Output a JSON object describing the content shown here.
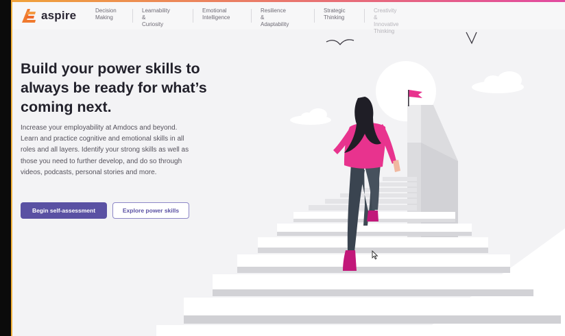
{
  "brand": {
    "name": "aspire",
    "colors": {
      "accent": "#f07a2e",
      "primary": "#5a51a3",
      "pink": "#e8338e"
    }
  },
  "nav": [
    {
      "label": "Decision\nMaking",
      "faded": false
    },
    {
      "label": "Learnability &\nCuriosity",
      "faded": false
    },
    {
      "label": "Emotional\nIntelligence",
      "faded": false
    },
    {
      "label": "Resilience &\nAdaptability",
      "faded": false
    },
    {
      "label": "Strategic\nThinking",
      "faded": false
    },
    {
      "label": "Creativity &\nInnovative Thinking",
      "faded": true
    }
  ],
  "hero": {
    "headline": "Build your power skills to always be ready for what’s coming next.",
    "intro": "Increase your employability at Amdocs and beyond. Learn and practice cognitive and emotional skills in all roles and all layers. Identify your strong skills as well as those you need to further develop, and do so through videos, podcasts, personal stories and more.",
    "primary_button": "Begin self-assessment",
    "secondary_button": "Explore power skills"
  },
  "illustration": {
    "icons": [
      "bird-icon",
      "flag-icon",
      "cloud-icon",
      "sun-icon",
      "stairs",
      "woman-climbing"
    ]
  }
}
